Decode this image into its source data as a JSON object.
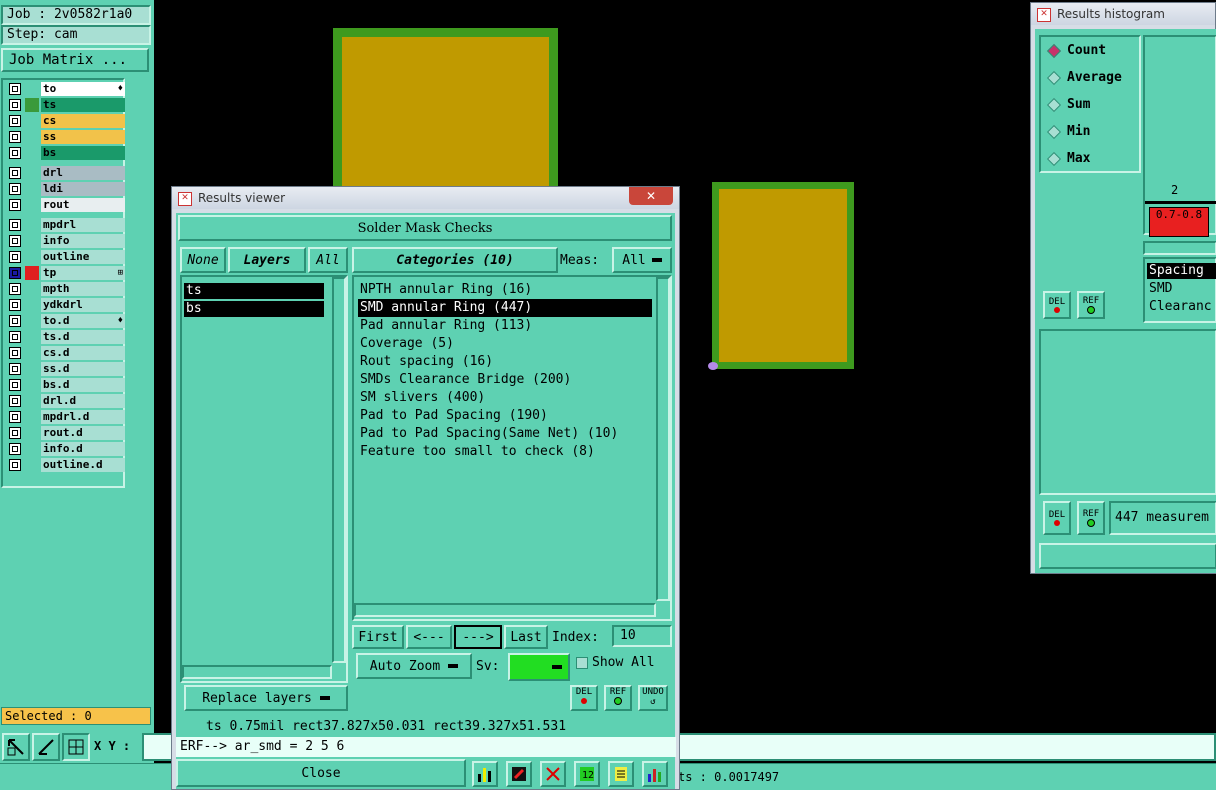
{
  "left_panel": {
    "job": "Job : 2v0582r1a0",
    "step": "Step: cam",
    "job_matrix_button": "Job Matrix ...",
    "layers": [
      {
        "name": "to",
        "color": "#ffffff",
        "mark": "♦"
      },
      {
        "name": "ts",
        "color": "#1a9a6a",
        "swatch": "#3a9a3a"
      },
      {
        "name": "cs",
        "color": "#f2c24a"
      },
      {
        "name": "ss",
        "color": "#f2c24a"
      },
      {
        "name": "bs",
        "color": "#1a9a6a"
      },
      {
        "name": "drl",
        "color": "#a9bcc4"
      },
      {
        "name": "ldi",
        "color": "#a9bcc4"
      },
      {
        "name": "rout",
        "color": "#e8eef0"
      },
      {
        "name": "mpdrl",
        "color": "#a8dfd3"
      },
      {
        "name": "info",
        "color": "#a8dfd3"
      },
      {
        "name": "outline",
        "color": "#a8dfd3"
      },
      {
        "name": "tp",
        "color": "#a8dfd3",
        "swatch": "#e02020",
        "mark": "⊞",
        "checked": true
      },
      {
        "name": "mpth",
        "color": "#a8dfd3"
      },
      {
        "name": "ydkdrl",
        "color": "#a8dfd3"
      },
      {
        "name": "to.d",
        "color": "#a8dfd3",
        "mark": "♦"
      },
      {
        "name": "ts.d",
        "color": "#a8dfd3"
      },
      {
        "name": "cs.d",
        "color": "#a8dfd3"
      },
      {
        "name": "ss.d",
        "color": "#a8dfd3"
      },
      {
        "name": "bs.d",
        "color": "#a8dfd3"
      },
      {
        "name": "drl.d",
        "color": "#a8dfd3"
      },
      {
        "name": "mpdrl.d",
        "color": "#a8dfd3"
      },
      {
        "name": "rout.d",
        "color": "#a8dfd3"
      },
      {
        "name": "info.d",
        "color": "#a8dfd3"
      },
      {
        "name": "outline.d",
        "color": "#a8dfd3"
      }
    ],
    "selected": "Selected : 0",
    "xy_label": "X Y :"
  },
  "results_viewer": {
    "title": "Results viewer",
    "header": "Solder Mask Checks",
    "none_btn": "None",
    "layers_btn": "Layers",
    "all_btn": "All",
    "layers": [
      "ts",
      "bs"
    ],
    "categories_btn": "Categories (10)",
    "meas_label": "Meas:",
    "meas_value": "All",
    "categories": [
      "NPTH annular Ring (16)",
      "SMD annular Ring (447)",
      "Pad annular Ring (113)",
      "Coverage (5)",
      "Rout spacing (16)",
      "SMDs Clearance Bridge (200)",
      "SM slivers (400)",
      "Pad to Pad Spacing (190)",
      "Pad to Pad Spacing(Same Net) (10)",
      "Feature too small to check (8)"
    ],
    "selected_category_index": 1,
    "first_btn": "First",
    "prev_btn": "<---",
    "next_btn": "--->",
    "last_btn": "Last",
    "index_label": "Index:",
    "index_value": "10",
    "auto_zoom": "Auto Zoom",
    "sv_label": "Sv:",
    "show_all": "Show All",
    "replace_layers": "Replace layers",
    "del": "DEL",
    "ref": "REF",
    "undo": "UNDO",
    "info_line": "ts 0.75mil   rect37.827x50.031   rect39.327x51.531",
    "erf_line": "ERF--> ar_smd = 2 5 6",
    "close": "Close"
  },
  "status": {
    "right_text": "ts : 0.0017497"
  },
  "histogram": {
    "title": "Results histogram",
    "options": [
      "Count",
      "Average",
      "Sum",
      "Min",
      "Max"
    ],
    "selected": "Count",
    "bar_count_label": "2",
    "bin_label": "0.7-0.8",
    "list": [
      "Spacing",
      "SMD",
      "Clearanc"
    ],
    "del": "DEL",
    "ref": "REF",
    "measurements": "447 measurem"
  },
  "colors": {
    "panel": "#5ed1b2",
    "pad_fill": "#c09a00",
    "pad_border": "#3e9a1e",
    "selected_bg": "#000000",
    "sv_green": "#22dd22"
  }
}
